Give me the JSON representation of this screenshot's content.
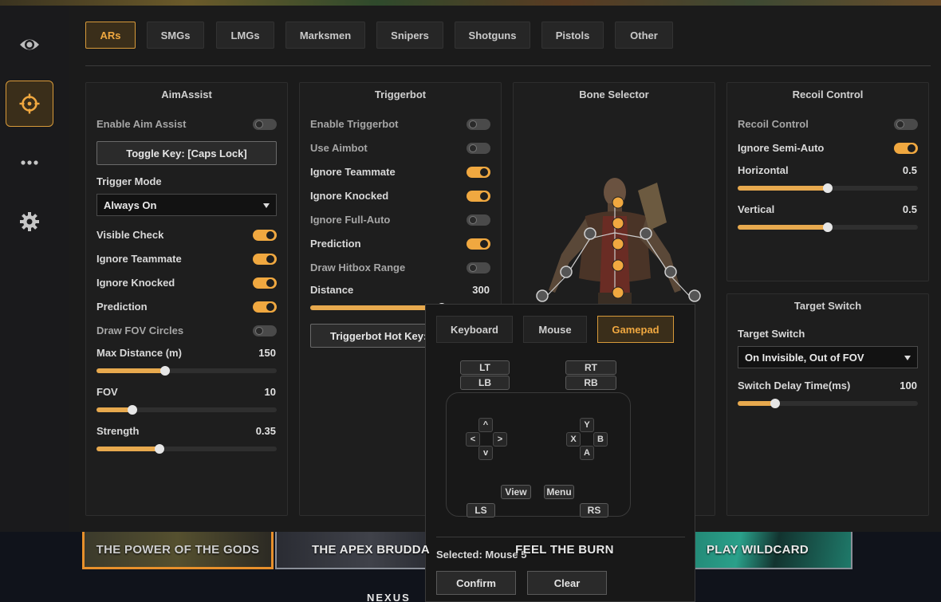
{
  "sidebar": {
    "items": [
      {
        "name": "eye-icon",
        "active": false
      },
      {
        "name": "crosshair-icon",
        "active": true
      },
      {
        "name": "more-icon",
        "active": false
      },
      {
        "name": "gear-icon",
        "active": false
      }
    ]
  },
  "tabs": [
    {
      "label": "ARs",
      "active": true
    },
    {
      "label": "SMGs",
      "active": false
    },
    {
      "label": "LMGs",
      "active": false
    },
    {
      "label": "Marksmen",
      "active": false
    },
    {
      "label": "Snipers",
      "active": false
    },
    {
      "label": "Shotguns",
      "active": false
    },
    {
      "label": "Pistols",
      "active": false
    },
    {
      "label": "Other",
      "active": false
    }
  ],
  "aimassist": {
    "title": "AimAssist",
    "enable_label": "Enable Aim Assist",
    "enable_on": false,
    "toggle_key": "Toggle Key: [Caps Lock]",
    "trigger_mode_label": "Trigger Mode",
    "trigger_mode_value": "Always On",
    "toggles": [
      {
        "label": "Visible Check",
        "on": true
      },
      {
        "label": "Ignore Teammate",
        "on": true
      },
      {
        "label": "Ignore Knocked",
        "on": true
      },
      {
        "label": "Prediction",
        "on": true
      },
      {
        "label": "Draw FOV Circles",
        "on": false
      }
    ],
    "sliders": [
      {
        "label": "Max Distance (m)",
        "value": "150",
        "fraction": 0.38
      },
      {
        "label": "FOV",
        "value": "10",
        "fraction": 0.2
      },
      {
        "label": "Strength",
        "value": "0.35",
        "fraction": 0.35
      }
    ]
  },
  "triggerbot": {
    "title": "Triggerbot",
    "toggles": [
      {
        "label": "Enable Triggerbot",
        "on": false
      },
      {
        "label": "Use Aimbot",
        "on": false
      },
      {
        "label": "Ignore Teammate",
        "on": true
      },
      {
        "label": "Ignore Knocked",
        "on": true
      },
      {
        "label": "Ignore Full-Auto",
        "on": false
      },
      {
        "label": "Prediction",
        "on": true
      },
      {
        "label": "Draw Hitbox Range",
        "on": false
      }
    ],
    "distance_label": "Distance",
    "distance_value": "300",
    "distance_fraction": 0.73,
    "hotkey": "Triggerbot Hot Key: [M"
  },
  "bone_selector": {
    "title": "Bone Selector"
  },
  "recoil": {
    "title": "Recoil Control",
    "toggles": [
      {
        "label": "Recoil Control",
        "on": false
      },
      {
        "label": "Ignore Semi-Auto",
        "on": true
      }
    ],
    "sliders": [
      {
        "label": "Horizontal",
        "value": "0.5",
        "fraction": 0.5
      },
      {
        "label": "Vertical",
        "value": "0.5",
        "fraction": 0.5
      }
    ]
  },
  "target_switch": {
    "title": "Target Switch",
    "label": "Target Switch",
    "value": "On Invisible, Out of FOV",
    "delay_label": "Switch Delay Time(ms)",
    "delay_value": "100",
    "delay_fraction": 0.21
  },
  "popup": {
    "tabs": [
      {
        "label": "Keyboard",
        "active": false
      },
      {
        "label": "Mouse",
        "active": false
      },
      {
        "label": "Gamepad",
        "active": true
      }
    ],
    "lt": "LT",
    "lb": "LB",
    "rt": "RT",
    "rb": "RB",
    "dpad": {
      "up": "^",
      "left": "<",
      "right": ">",
      "down": "v"
    },
    "face": {
      "y": "Y",
      "x": "X",
      "b": "B",
      "a": "A"
    },
    "view": "View",
    "menu": "Menu",
    "ls": "LS",
    "rs": "RS",
    "selected": "Selected: Mouse 5",
    "confirm": "Confirm",
    "clear": "Clear"
  },
  "banners": [
    {
      "label": "THE POWER OF THE GODS"
    },
    {
      "label": "THE APEX BRUDDA"
    },
    {
      "label": "FEEL THE BURN"
    },
    {
      "label": "PLAY WILDCARD"
    }
  ],
  "bottom_logo": "NEXUS",
  "colors": {
    "accent": "#f0a840",
    "panel": "#1e1e1e",
    "background": "#1b1b1b"
  }
}
